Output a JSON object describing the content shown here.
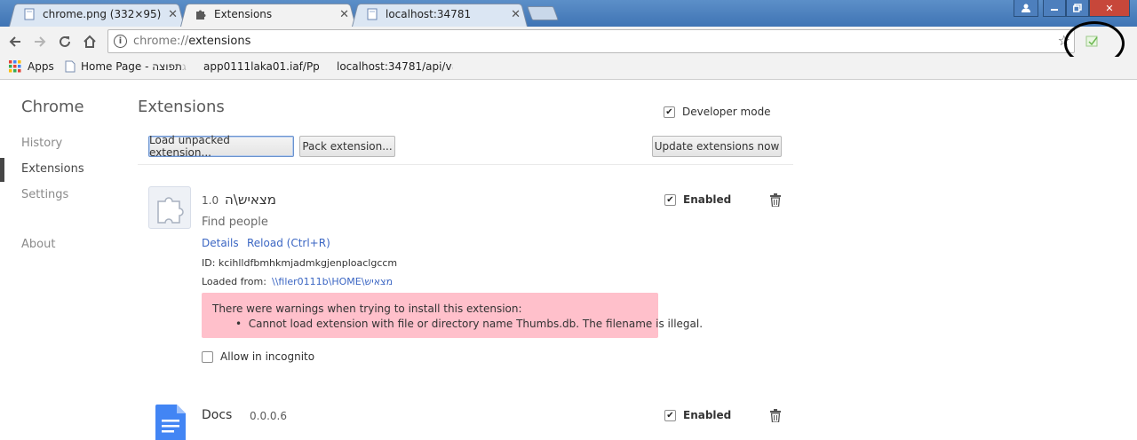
{
  "tabs": [
    {
      "label": "chrome.png (332×95)",
      "icon": "file-icon",
      "active": false
    },
    {
      "label": "Extensions",
      "icon": "puzzle-icon",
      "active": true
    },
    {
      "label": "localhost:34781",
      "icon": "file-icon",
      "active": false
    }
  ],
  "window_controls": {
    "user": "user-icon",
    "minimize": "minimize-icon",
    "maximize": "maximize-icon",
    "close": "✕"
  },
  "toolbar": {
    "address_scheme": "chrome://",
    "address_path": "extensions"
  },
  "bookmarks": [
    {
      "label": "Apps",
      "icon": "apps-grid-icon"
    },
    {
      "label": "Home Page - תפוצה",
      "faded": " ‎ג",
      "icon": "page-icon"
    },
    {
      "label": "app0111laka01.iaf/Pp",
      "faded": "p",
      "icon": "doc-icon"
    },
    {
      "label": "localhost:34781/api/v",
      "faded": "a",
      "icon": "page-icon"
    }
  ],
  "sidebar": {
    "title": "Chrome",
    "items": [
      {
        "label": "History",
        "selected": false
      },
      {
        "label": "Extensions",
        "selected": true
      },
      {
        "label": "Settings",
        "selected": false
      },
      {
        "label": "About",
        "selected": false
      }
    ]
  },
  "main": {
    "title": "Extensions",
    "developer_mode": {
      "label": "Developer mode",
      "checked": true
    },
    "buttons": {
      "load_unpacked": "Load unpacked extension...",
      "pack": "Pack extension...",
      "update": "Update extensions now"
    },
    "extensions": [
      {
        "name": "מצאיש\\ה",
        "version": "1.0",
        "description": "Find people",
        "links": {
          "details": "Details",
          "reload": "Reload (Ctrl+R)"
        },
        "id_label": "ID:",
        "id": "kcihlldfbmhkmjadmkgjenploaclgccm",
        "loaded_from_label": "Loaded from:",
        "loaded_from": "\\\\filer0111b\\HOME\\מצאיש",
        "warning_title": "There were warnings when trying to install this extension:",
        "warning_item": "Cannot load extension with file or directory name Thumbs.db. The filename is illegal.",
        "incognito_label": "Allow in incognito",
        "incognito_checked": false,
        "enabled_label": "Enabled",
        "enabled": true
      },
      {
        "name": "Docs",
        "version": "0.0.0.6",
        "enabled_label": "Enabled",
        "enabled": true
      }
    ]
  },
  "colors": {
    "accent_link": "#3b66c3",
    "warning_bg": "#ffc0cb",
    "title_bar": "#3f74b4"
  }
}
